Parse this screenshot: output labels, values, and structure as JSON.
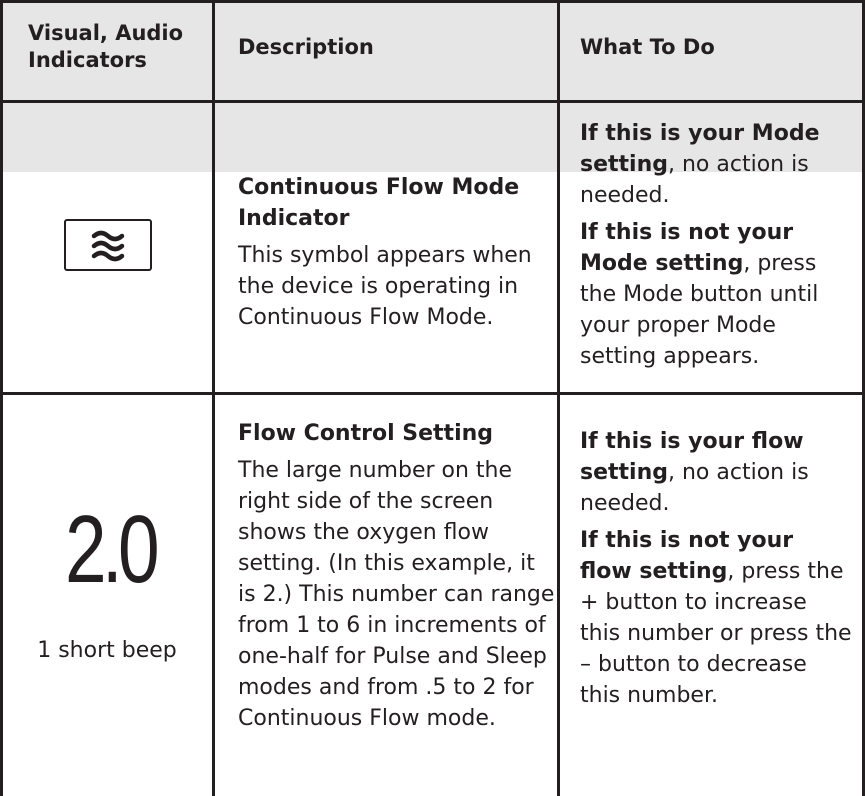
{
  "headers": {
    "col1": "Visual, Audio Indicators",
    "col2": "Description",
    "col3": "What To Do"
  },
  "rows": [
    {
      "indicator_icon": "continuous-flow-wave-icon",
      "description_title": "Continuous Flow Mode Indicator",
      "description_body": "This symbol appears when the device is operating in Continuous Flow Mode.",
      "action_1_bold": "If this is your Mode setting",
      "action_1_rest": ", no action is needed.",
      "action_2_bold": "If this is not your Mode setting",
      "action_2_rest": ", press the Mode button until your proper Mode setting appears."
    },
    {
      "indicator_value": "2.0",
      "indicator_audio": "1 short beep",
      "description_title": "Flow Control Setting",
      "description_body": "The large number on the right side of the screen shows the oxygen flow setting. (In this example, it is 2.)  This number can range from 1 to 6 in increments of one-half for Pulse and Sleep modes and from .5 to 2 for Continuous Flow mode.",
      "action_1_bold": "If this is your flow setting",
      "action_1_rest": ", no action is needed.",
      "action_2_bold": "If this is not your flow setting",
      "action_2_rest": ", press the + button to increase this number or press the – button to decrease this number."
    }
  ]
}
